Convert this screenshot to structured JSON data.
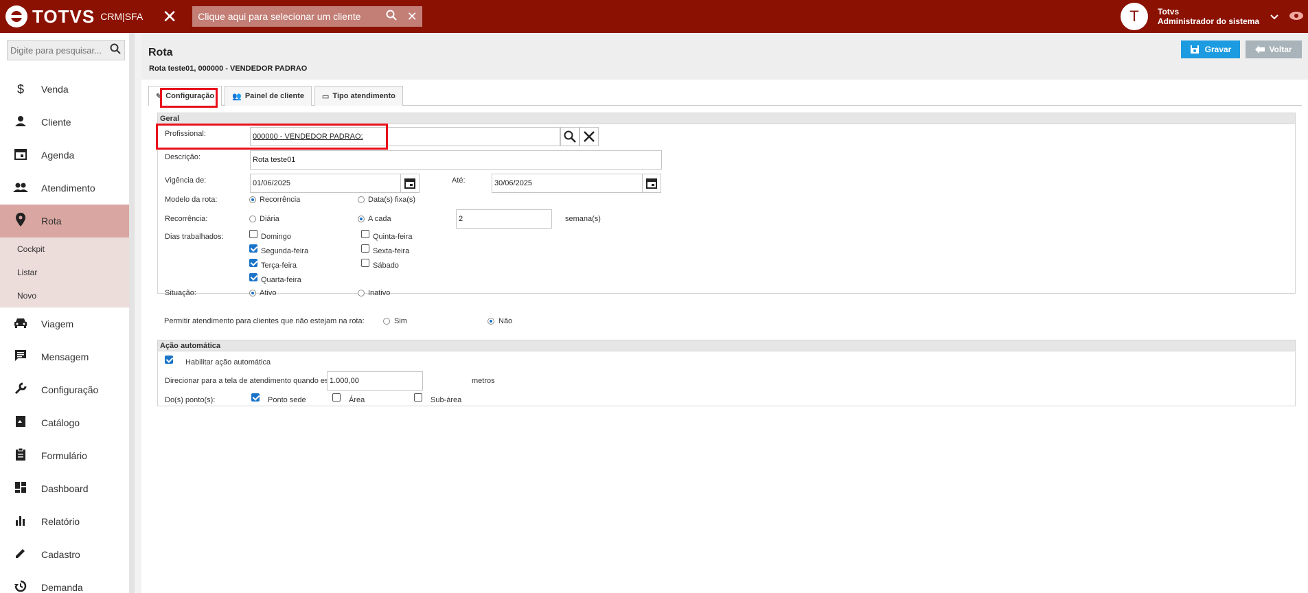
{
  "topbar": {
    "brand": "TOTVS",
    "product": "CRM|SFA",
    "client_select_placeholder": "Clique aqui para selecionar um cliente",
    "user_initial": "T",
    "user_name": "Totvs",
    "user_role": "Administrador do sistema"
  },
  "sidebar": {
    "search_placeholder": "Digite para pesquisar...",
    "items": [
      {
        "label": "Venda",
        "icon": "dollar-icon"
      },
      {
        "label": "Cliente",
        "icon": "person-icon"
      },
      {
        "label": "Agenda",
        "icon": "calendar-icon"
      },
      {
        "label": "Atendimento",
        "icon": "people-icon"
      },
      {
        "label": "Rota",
        "icon": "location-pin-icon"
      },
      {
        "label": "Viagem",
        "icon": "car-icon"
      },
      {
        "label": "Mensagem",
        "icon": "message-icon"
      },
      {
        "label": "Configuração",
        "icon": "wrench-icon"
      },
      {
        "label": "Catálogo",
        "icon": "book-icon"
      },
      {
        "label": "Formulário",
        "icon": "clipboard-icon"
      },
      {
        "label": "Dashboard",
        "icon": "dashboard-icon"
      },
      {
        "label": "Relatório",
        "icon": "bar-chart-icon"
      },
      {
        "label": "Cadastro",
        "icon": "pencil-icon"
      },
      {
        "label": "Demanda",
        "icon": "history-icon"
      }
    ],
    "rota_sub": [
      "Cockpit",
      "Listar",
      "Novo"
    ]
  },
  "header": {
    "title": "Rota",
    "subtitle": "Rota teste01, 000000 - VENDEDOR PADRAO",
    "save_label": "Gravar",
    "back_label": "Voltar"
  },
  "tabs": [
    "Configuração",
    "Painel de cliente",
    "Tipo atendimento"
  ],
  "geral": {
    "title": "Geral",
    "profissional_label": "Profissional:",
    "profissional_value": "000000 - VENDEDOR PADRAO;",
    "descricao_label": "Descrição:",
    "descricao_value": "Rota teste01",
    "vigencia_label": "Vigência de:",
    "vigencia_from": "01/06/2025",
    "ate_label": "Até:",
    "vigencia_to": "30/06/2025",
    "modelo_label": "Modelo da rota:",
    "modelo_opt1": "Recorrência",
    "modelo_opt2": "Data(s) fixa(s)",
    "recorrencia_label": "Recorrência:",
    "rec_opt1": "Diária",
    "rec_opt2": "A cada",
    "rec_value": "2",
    "rec_unit": "semana(s)",
    "dias_label": "Dias trabalhados:",
    "dias": {
      "domingo": "Domingo",
      "segunda": "Segunda-feira",
      "terca": "Terça-feira",
      "quarta": "Quarta-feira",
      "quinta": "Quinta-feira",
      "sexta": "Sexta-feira",
      "sabado": "Sábado"
    },
    "situacao_label": "Situação:",
    "sit_opt1": "Ativo",
    "sit_opt2": "Inativo",
    "permitir_label": "Permitir atendimento para clientes que não estejam na rota:",
    "permitir_opt1": "Sim",
    "permitir_opt2": "Não"
  },
  "acao": {
    "title": "Ação automática",
    "habilitar_label": "Habilitar ação automática",
    "direcionar_label": "Direcionar para a tela de atendimento quando estiver à:",
    "direcionar_value": "1.000,00",
    "direcionar_unit": "metros",
    "pontos_label": "Do(s) ponto(s):",
    "ponto_sede": "Ponto sede",
    "area": "Área",
    "subarea": "Sub-área"
  },
  "colors": {
    "topbar": "#8b1203",
    "active_menu": "#d9a6a1",
    "save_button": "#1c9be0",
    "back_button": "#a9b3ba",
    "checkbox": "#1a73c9",
    "highlight_box": "#e8101b"
  }
}
